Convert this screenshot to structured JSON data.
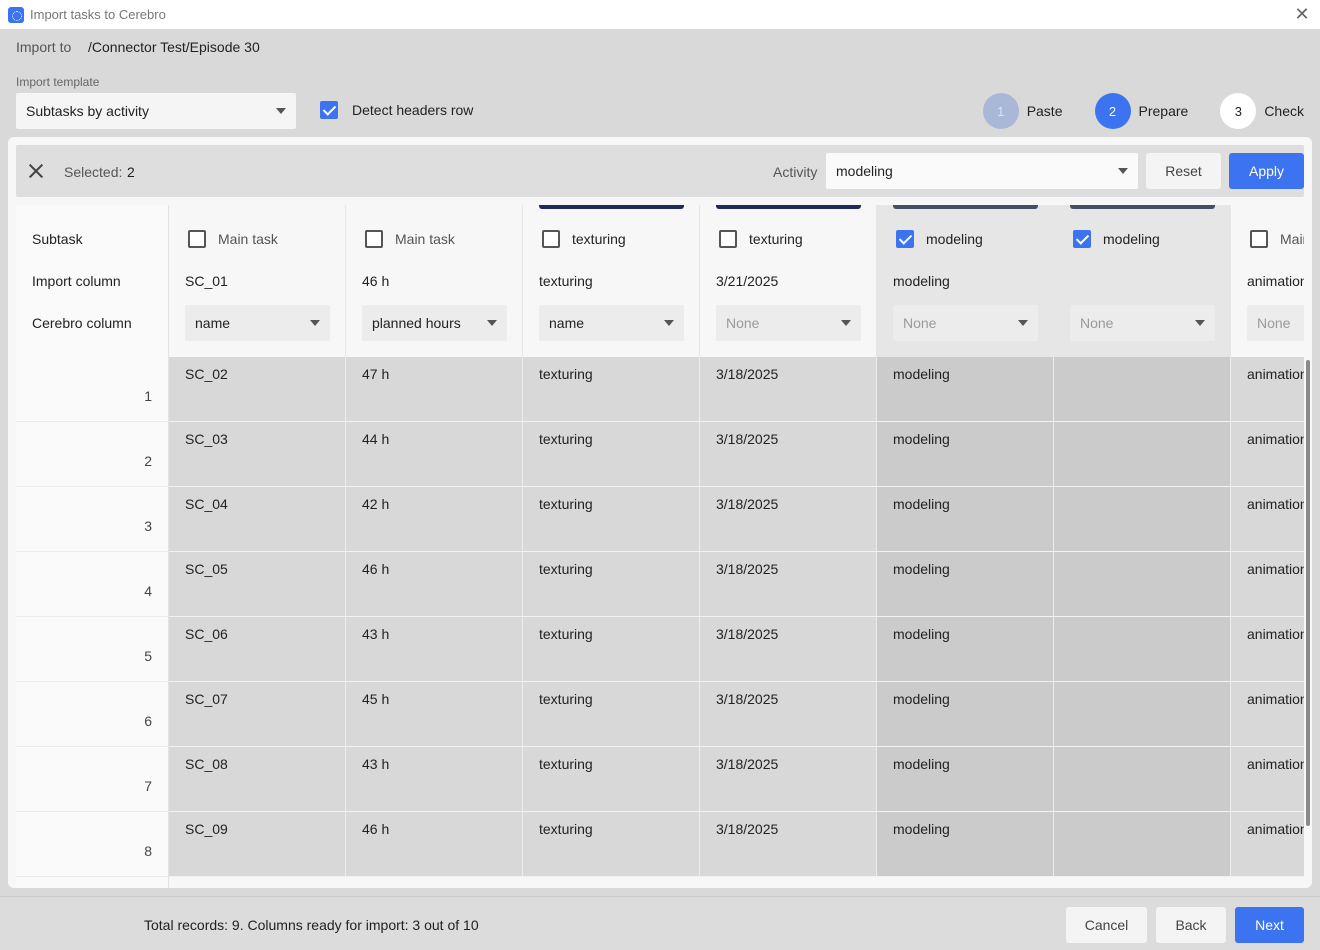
{
  "window": {
    "title": "Import tasks to Cerebro"
  },
  "import_to": {
    "label": "Import to",
    "path": "/Connector Test/Episode 30"
  },
  "template": {
    "label": "Import template",
    "value": "Subtasks by activity"
  },
  "detect_headers": {
    "label": "Detect headers row",
    "checked": true
  },
  "steps": [
    {
      "number": "1",
      "label": "Paste",
      "state": "done"
    },
    {
      "number": "2",
      "label": "Prepare",
      "state": "active"
    },
    {
      "number": "3",
      "label": "Check",
      "state": "todo"
    }
  ],
  "selection_bar": {
    "selected_label": "Selected:",
    "selected_count": "2",
    "activity_label": "Activity",
    "activity_value": "modeling",
    "reset_label": "Reset",
    "apply_label": "Apply"
  },
  "grid": {
    "row_labels": {
      "subtask": "Subtask",
      "import_column": "Import column",
      "cerebro_column": "Cerebro column"
    },
    "columns": [
      {
        "header": "Main task",
        "checked": false,
        "import_column": "SC_01",
        "cerebro_column": "name",
        "bar_color": "",
        "cells": [
          "SC_02",
          "SC_03",
          "SC_04",
          "SC_05",
          "SC_06",
          "SC_07",
          "SC_08",
          "SC_09"
        ]
      },
      {
        "header": "Main task",
        "checked": false,
        "import_column": "46 h",
        "cerebro_column": "planned hours",
        "bar_color": "",
        "cells": [
          "47 h",
          "44 h",
          "42 h",
          "46 h",
          "43 h",
          "45 h",
          "43 h",
          "46 h"
        ]
      },
      {
        "header": "texturing",
        "checked": false,
        "import_column": "texturing",
        "cerebro_column": "name",
        "bar_color": "#1e2a5a",
        "cells": [
          "texturing",
          "texturing",
          "texturing",
          "texturing",
          "texturing",
          "texturing",
          "texturing",
          "texturing"
        ]
      },
      {
        "header": "texturing",
        "checked": false,
        "import_column": "3/21/2025",
        "cerebro_column": "None",
        "bar_color": "#1e2a5a",
        "cells": [
          "3/18/2025",
          "3/18/2025",
          "3/18/2025",
          "3/18/2025",
          "3/18/2025",
          "3/18/2025",
          "3/18/2025",
          "3/18/2025"
        ]
      },
      {
        "header": "modeling",
        "checked": true,
        "import_column": "modeling",
        "cerebro_column": "None",
        "bar_color": "#465063",
        "cells": [
          "modeling",
          "modeling",
          "modeling",
          "modeling",
          "modeling",
          "modeling",
          "modeling",
          "modeling"
        ]
      },
      {
        "header": "modeling",
        "checked": true,
        "import_column": "",
        "cerebro_column": "None",
        "bar_color": "#465063",
        "cells": [
          "",
          "",
          "",
          "",
          "",
          "",
          "",
          ""
        ]
      },
      {
        "header": "Main task",
        "checked": false,
        "import_column": "animation",
        "cerebro_column": "None",
        "bar_color": "",
        "cells": [
          "animation",
          "animation",
          "animation",
          "animation",
          "animation",
          "animation",
          "animation",
          "animation"
        ]
      }
    ],
    "row_numbers": [
      "1",
      "2",
      "3",
      "4",
      "5",
      "6",
      "7",
      "8"
    ]
  },
  "footer": {
    "summary": "Total records: 9. Columns ready for import: 3 out of 10",
    "cancel_label": "Cancel",
    "back_label": "Back",
    "next_label": "Next"
  },
  "colors": {
    "accent": "#3b73f0",
    "step_done": "#aab8d8"
  }
}
